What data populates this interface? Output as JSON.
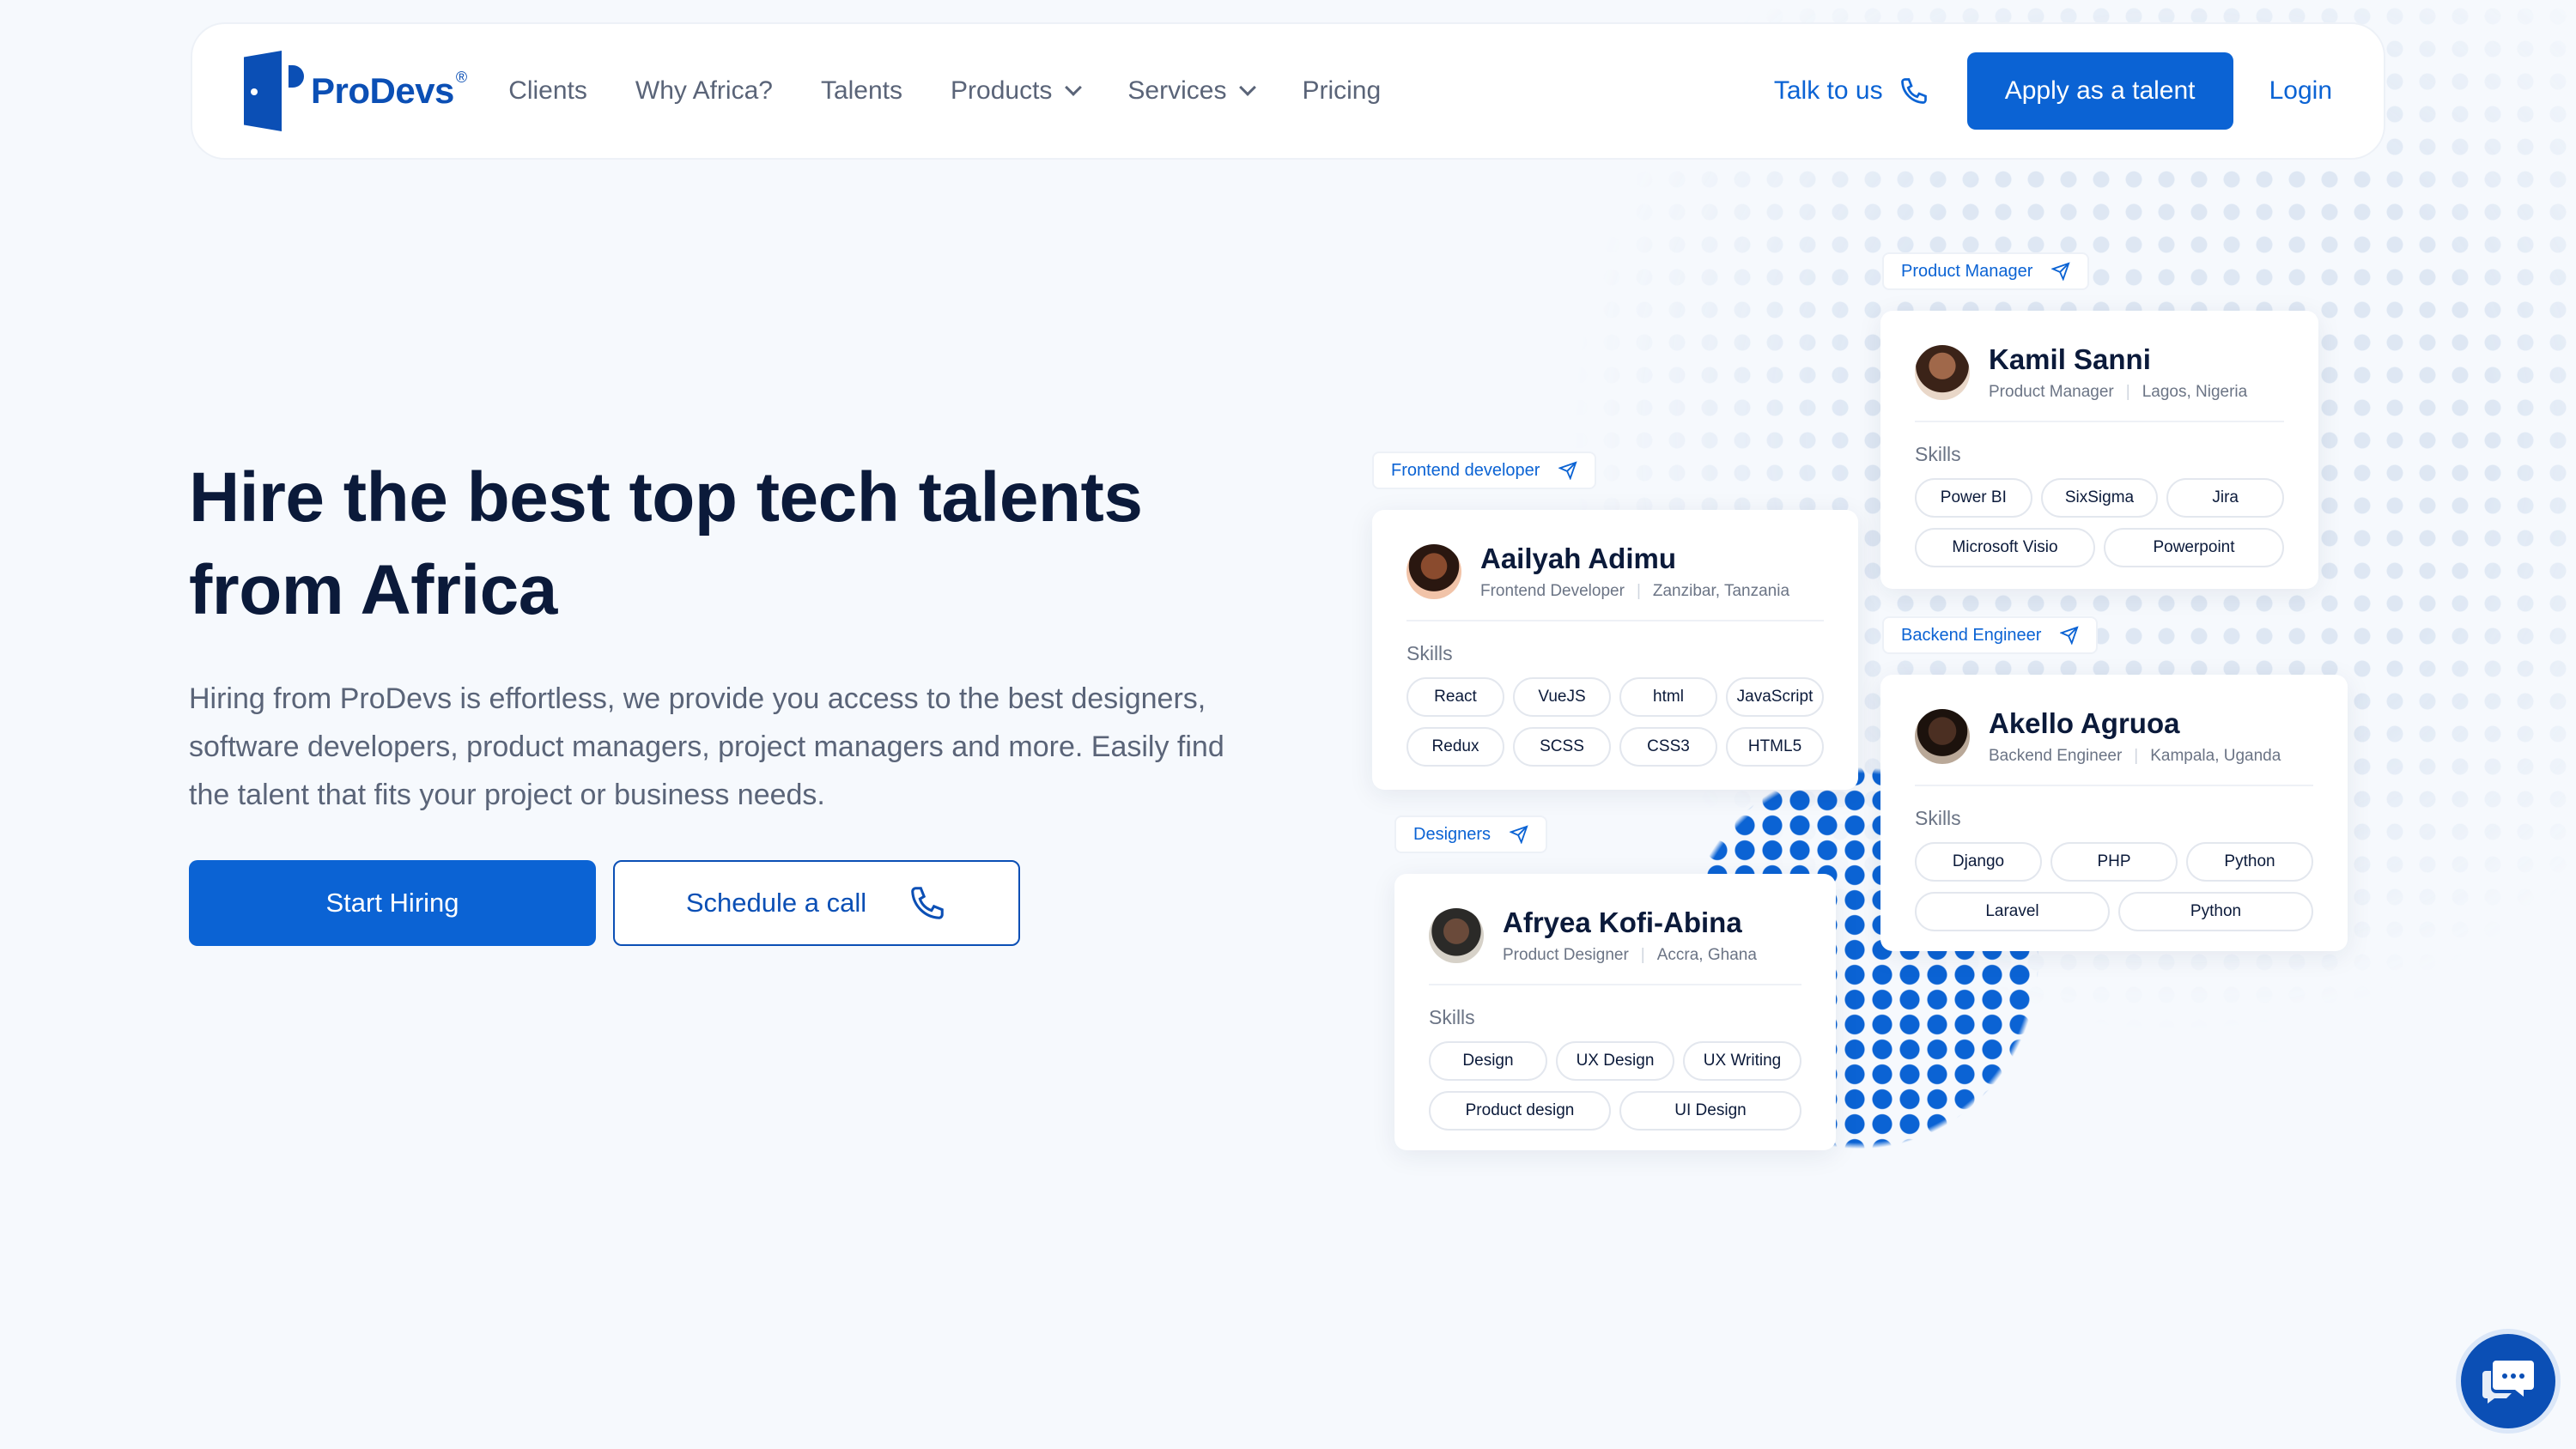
{
  "brand": {
    "name": "ProDevs",
    "reg": "®"
  },
  "nav": {
    "links": [
      "Clients",
      "Why Africa?",
      "Talents",
      "Products",
      "Services",
      "Pricing"
    ],
    "talk": "Talk to us",
    "apply": "Apply as a talent",
    "login": "Login"
  },
  "hero": {
    "title_line1": "Hire the best top tech talents",
    "title_line2": "from Africa",
    "subtitle": "Hiring from ProDevs is effortless, we provide you access to the best designers, software developers, product managers, project managers and more. Easily find the talent that fits your project or business needs.",
    "start": "Start Hiring",
    "schedule": "Schedule a call"
  },
  "skills_label": "Skills",
  "cards": [
    {
      "tag": "Product Manager",
      "name": "Kamil Sanni",
      "role": "Product Manager",
      "location": "Lagos, Nigeria",
      "skills": [
        "Power BI",
        "SixSigma",
        "Jira",
        "Microsoft Visio",
        "Powerpoint"
      ]
    },
    {
      "tag": "Frontend developer",
      "name": "Aailyah Adimu",
      "role": "Frontend Developer",
      "location": "Zanzibar, Tanzania",
      "skills": [
        "React",
        "VueJS",
        "html",
        "JavaScript",
        "Redux",
        "SCSS",
        "CSS3",
        "HTML5"
      ]
    },
    {
      "tag": "Backend Engineer",
      "name": "Akello Agruoa",
      "role": "Backend Engineer",
      "location": "Kampala, Uganda",
      "skills": [
        "Django",
        "PHP",
        "Python",
        "Laravel",
        "Python"
      ]
    },
    {
      "tag": "Designers",
      "name": "Afryea Kofi-Abina",
      "role": "Product Designer",
      "location": "Accra, Ghana",
      "skills": [
        "Design",
        "UX Design",
        "UX Writing",
        "Product design",
        "UI Design"
      ]
    }
  ],
  "colors": {
    "primary": "#0b63d4",
    "dark": "#0b1a3a",
    "muted": "#5a6478"
  }
}
